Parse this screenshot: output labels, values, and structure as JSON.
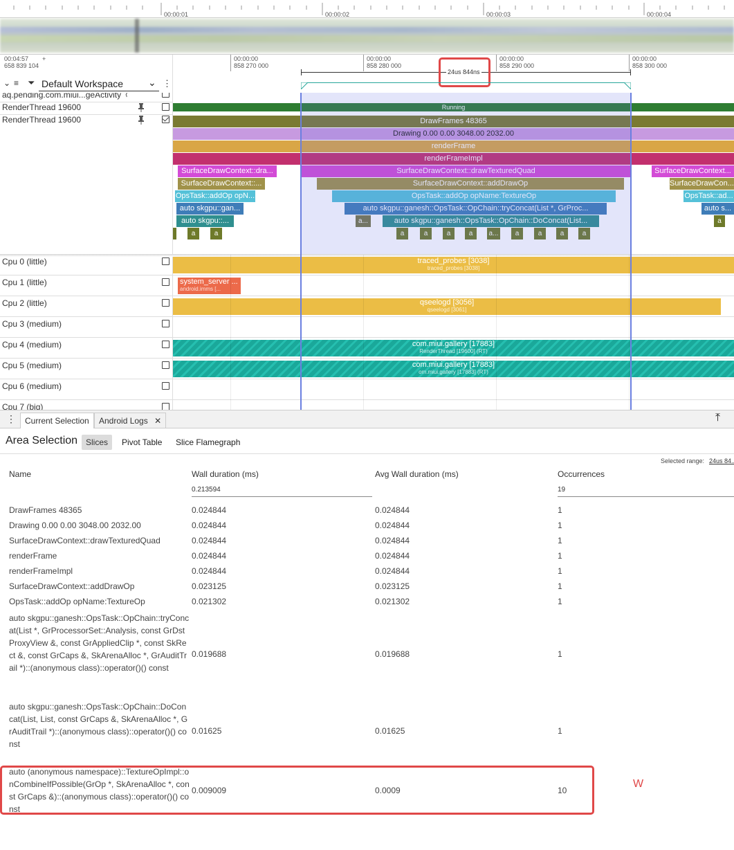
{
  "overview": {
    "ticks": [
      "00:00:01",
      "00:00:02",
      "00:00:03",
      "00:00:04"
    ]
  },
  "timeline": {
    "offset_top": "00:04:57",
    "offset_plus": "+",
    "offset_bottom": "658 839 104",
    "ticks": [
      {
        "top": "00:00:00",
        "bottom": "858 270 000"
      },
      {
        "top": "00:00:00",
        "bottom": "858 280 000"
      },
      {
        "top": "00:00:00",
        "bottom": "858 290 000"
      },
      {
        "top": "00:00:00",
        "bottom": "858 300 000"
      }
    ],
    "selection_duration": "24us 844ns"
  },
  "workspace": {
    "name": "Default Workspace"
  },
  "tracks": {
    "partial_top": "aq.pending.com.miui...geActivity",
    "render_thread_1": "RenderThread 19600",
    "render_thread_2": "RenderThread 19600",
    "running_label": "Running"
  },
  "slices": {
    "drawframes": "DrawFrames 48365",
    "drawing": "Drawing  0.00  0.00 3048.00 2032.00",
    "renderframe": "renderFrame",
    "renderframeimpl": "renderFrameImpl",
    "sdc_draw_left": "SurfaceDrawContext::dra...",
    "sdc_draw_mid": "SurfaceDrawContext::drawTexturedQuad",
    "sdc_draw_right": "SurfaceDrawContext...",
    "sdc_add_left": "SurfaceDrawContext::...",
    "sdc_add_mid": "SurfaceDrawContext::addDrawOp",
    "sdc_add_right": "SurfaceDrawCon...",
    "ops_left": "OpsTask::addOp opN...",
    "ops_mid": "OpsTask::addOp opName:TextureOp",
    "ops_right": "OpsTask::ad...",
    "auto_gan_left": "auto skgpu::gan...",
    "auto_tryconcat": "auto skgpu::ganesh::OpsTask::OpChain::tryConcat(List *, GrProc...",
    "auto_right": "auto s...",
    "auto_left2": "auto skgpu::...",
    "a_short": "a...",
    "auto_doconcat": "auto skgpu::ganesh::OpsTask::OpChain::DoConcat(List...",
    "a": "a"
  },
  "cpus": [
    {
      "name": "Cpu 0 (little)",
      "slice": "traced_probes [3038]",
      "sub": "traced_probes [3038]"
    },
    {
      "name": "Cpu 1 (little)",
      "slice": "system_server ...",
      "sub": "android.imms [..."
    },
    {
      "name": "Cpu 2 (little)",
      "slice": "qseelogd [3056]",
      "sub": "qseelogd [3061]"
    },
    {
      "name": "Cpu 3 (medium)"
    },
    {
      "name": "Cpu 4 (medium)",
      "slice": "com.miui.gallery [17883]",
      "sub": "RenderThread [19600] (RT)"
    },
    {
      "name": "Cpu 5 (medium)",
      "slice": "com.miui.gallery [17883]",
      "sub": "om.miui.gallery [17883] (RT)"
    },
    {
      "name": "Cpu 6 (medium)"
    },
    {
      "name": "Cpu 7 (big)"
    }
  ],
  "bottom_tabs": {
    "current_selection": "Current Selection",
    "android_logs": "Android Logs"
  },
  "panel": {
    "title": "Area Selection",
    "tab_slices": "Slices",
    "tab_pivot": "Pivot Table",
    "tab_flamegraph": "Slice Flamegraph",
    "selected_range_label": "Selected range:",
    "selected_range_value": "24us 84..."
  },
  "table": {
    "headers": [
      "Name",
      "Wall duration (ms)",
      "Avg Wall duration (ms)",
      "Occurrences"
    ],
    "totals": {
      "wall": "0.213594",
      "occ": "19"
    },
    "rows": [
      {
        "name": "DrawFrames 48365",
        "wall": "0.024844",
        "avg": "0.024844",
        "occ": "1"
      },
      {
        "name": "Drawing 0.00 0.00 3048.00 2032.00",
        "wall": "0.024844",
        "avg": "0.024844",
        "occ": "1"
      },
      {
        "name": "SurfaceDrawContext::drawTexturedQuad",
        "wall": "0.024844",
        "avg": "0.024844",
        "occ": "1"
      },
      {
        "name": "renderFrame",
        "wall": "0.024844",
        "avg": "0.024844",
        "occ": "1"
      },
      {
        "name": "renderFrameImpl",
        "wall": "0.024844",
        "avg": "0.024844",
        "occ": "1"
      },
      {
        "name": "SurfaceDrawContext::addDrawOp",
        "wall": "0.023125",
        "avg": "0.023125",
        "occ": "1"
      },
      {
        "name": "OpsTask::addOp opName:TextureOp",
        "wall": "0.021302",
        "avg": "0.021302",
        "occ": "1"
      },
      {
        "name": "auto skgpu::ganesh::OpsTask::OpChain::tryConcat(List *, GrProcessorSet::Analysis, const GrDstProxyView &, const GrAppliedClip *, const SkRect &, const GrCaps &, SkArenaAlloc *, GrAuditTrail *)::(anonymous class)::operator()() const",
        "wall": "0.019688",
        "avg": "0.019688",
        "occ": "1"
      },
      {
        "name": "auto skgpu::ganesh::OpsTask::OpChain::DoConcat(List, List, const GrCaps &, SkArenaAlloc *, GrAuditTrail *)::(anonymous class)::operator()() const",
        "wall": "0.01625",
        "avg": "0.01625",
        "occ": "1"
      },
      {
        "name": "auto (anonymous namespace)::TextureOpImpl::onCombineIfPossible(GrOp *, SkArenaAlloc *, const GrCaps &)::(anonymous class)::operator()() const",
        "wall": "0.009009",
        "avg": "0.0009",
        "occ": "10"
      }
    ],
    "annotation_letter": "W"
  },
  "colors": {
    "annotation_red": "#e04848",
    "selection_blue": "#6a7fe0",
    "running_green": "#2e7d32"
  }
}
